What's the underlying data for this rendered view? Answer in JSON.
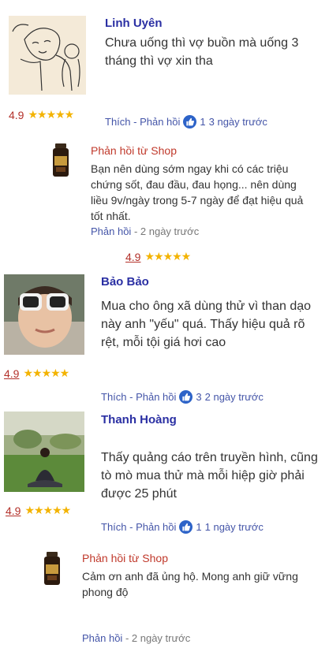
{
  "reviews": [
    {
      "name": "Linh Uyên",
      "text": "Chưa uống thì vợ buồn mà uống 3 tháng thì vợ xin tha",
      "rating": "4.9",
      "stars": "★★★★★",
      "action_label": "Thích - Phản hồi",
      "likes": "1",
      "time": "3 ngày trước"
    },
    {
      "name": "Bảo Bảo",
      "text": "Mua cho ông xã dùng thử vì than dạo này anh \"yếu\" quá. Thấy hiệu quả rõ rệt, mỗi tội giá hơi cao",
      "rating": "4.9",
      "stars": "★★★★★",
      "action_label": "Thích - Phản hồi",
      "likes": "3",
      "time": "2 ngày trước"
    },
    {
      "name": "Thanh Hoàng",
      "text": "Thấy quảng cáo trên truyền hình, cũng tò mò mua thử mà mỗi hiệp giờ phải được 25 phút",
      "rating": "4.9",
      "stars": "★★★★★",
      "action_label": "Thích - Phản hồi",
      "likes": "1",
      "time": "1 ngày trước"
    }
  ],
  "shop_replies": [
    {
      "title": "Phản hồi từ Shop",
      "text": "Bạn nên dùng sớm ngay khi có các triệu chứng sốt, đau đầu, đau họng... nên dùng liều 9v/ngày trong 5-7 ngày để đạt hiệu quả tốt nhất.",
      "reply_label": "Phản hồi",
      "time": "- 2 ngày trước",
      "rating": "4.9",
      "stars": "★★★★★"
    },
    {
      "title": "Phản hồi từ Shop",
      "text": "Cảm ơn anh đã ủng hộ. Mong anh giữ vững phong độ",
      "reply_label": "Phản hồi",
      "time": "- 2 ngày trước"
    }
  ],
  "colors": {
    "name": "#2a2fa3",
    "rating": "#b3312a",
    "star": "#f3b300",
    "shop_title": "#c0392b",
    "like_button": "#2d63c8"
  }
}
